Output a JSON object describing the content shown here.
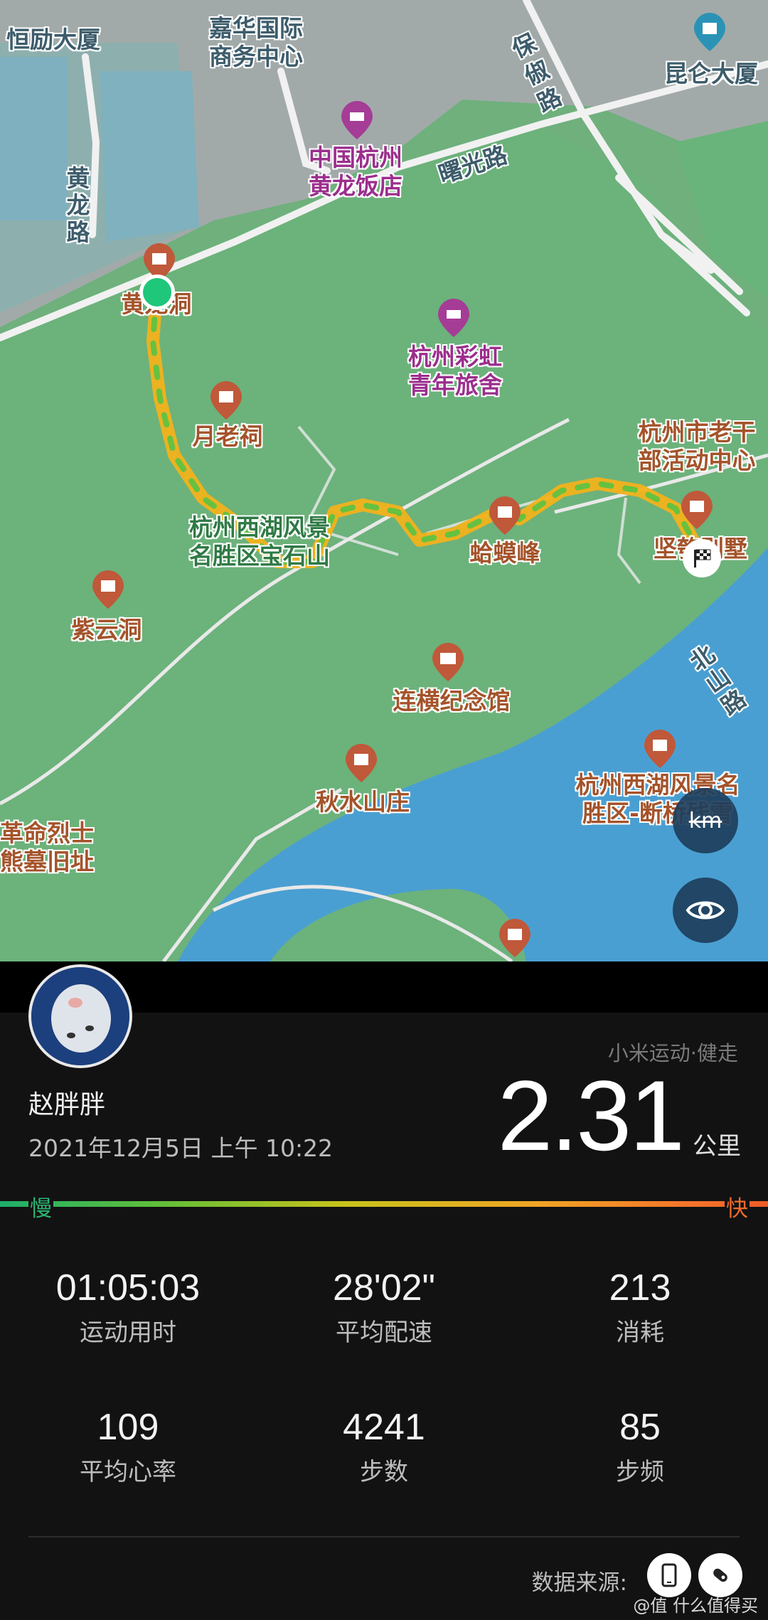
{
  "map": {
    "labels": {
      "hengli": "恒励大厦",
      "jiahua": "嘉华国际\n商务中心",
      "baochu": "保俶路",
      "kunlun": "昆仑大厦",
      "huanglong_hotel": "中国杭州\n黄龙饭店",
      "shuguang": "曙光路",
      "huanglong_road": "黄龙路",
      "huanglong_dong": "黄龙洞",
      "hostel": "杭州彩虹\n青年旅舍",
      "yuelao": "月老祠",
      "laogan": "杭州市老干\n部活动中心",
      "westlake_park": "杭州西湖风景\n名胜区宝石山",
      "hama": "蛤蟆峰",
      "jianzhi": "坚匏别墅",
      "ziyun": "紫云洞",
      "lianheng": "连横纪念馆",
      "qiushui": "秋水山庄",
      "duanqiao": "杭州西湖风景名\n胜区-断桥残雪",
      "geming": "革命烈士\n熊墓旧址",
      "beishan": "北山路"
    },
    "icons": [
      "pin-icon",
      "hotel-icon",
      "museum-icon",
      "finish-flag-icon",
      "start-point-icon"
    ]
  },
  "controls": {
    "unit_toggle_label": "km",
    "view_toggle_icon": "eye-icon"
  },
  "user": {
    "name": "赵胖胖",
    "datetime": "2021年12月5日 上午 10:22"
  },
  "workout": {
    "source_title": "小米运动·健走",
    "distance": "2.31",
    "distance_unit": "公里"
  },
  "pace_scale": {
    "slow": "慢",
    "fast": "快",
    "colors": [
      "#1fae6a",
      "#c8c21b",
      "#f0a424",
      "#ef5b28"
    ]
  },
  "stats": [
    {
      "value": "01:05:03",
      "label": "运动用时"
    },
    {
      "value": "28'02\"",
      "label": "平均配速"
    },
    {
      "value": "213",
      "label": "消耗"
    },
    {
      "value": "109",
      "label": "平均心率"
    },
    {
      "value": "4241",
      "label": "步数"
    },
    {
      "value": "85",
      "label": "步频"
    }
  ],
  "footer": {
    "source_label": "数据来源:",
    "source_icons": [
      "phone-icon",
      "band-icon"
    ],
    "watermark": "@值 什么值得买"
  }
}
